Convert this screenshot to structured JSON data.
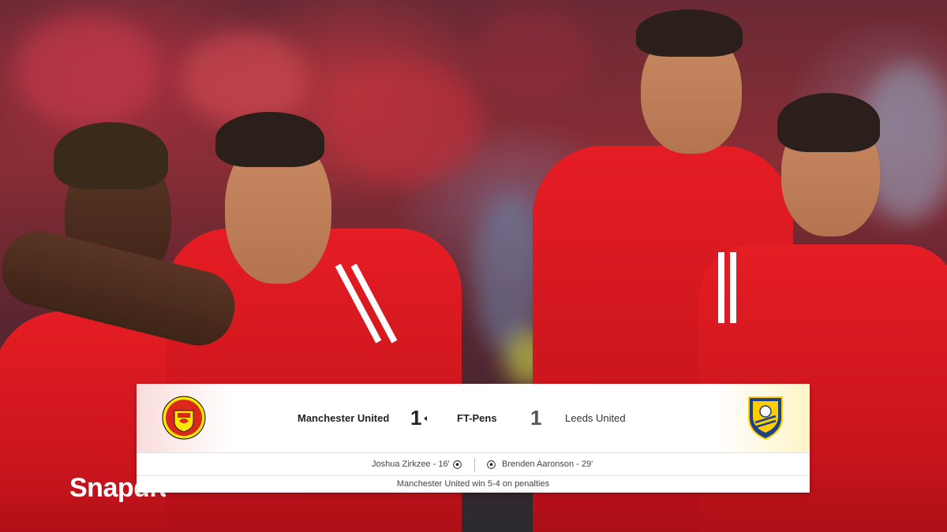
{
  "match": {
    "home_team": "Manchester United",
    "away_team": "Leeds United",
    "home_score": "1",
    "away_score": "1",
    "status": "FT-Pens",
    "home_scorer": "Joshua Zirkzee - 16'",
    "away_scorer": "Brenden Aaronson - 29'",
    "result_note": "Manchester United win 5-4 on penalties"
  },
  "crest_home": {
    "name": "manchester-united-crest",
    "text_top": "MANCHESTER",
    "text_bottom": "UNITED"
  },
  "crest_away": {
    "name": "leeds-united-crest"
  },
  "shirt_sponsor": "Snapdragon",
  "colors": {
    "home_primary": "#da291c",
    "away_primary": "#ffcd00",
    "away_secondary": "#1d428a",
    "panel_bg": "#ffffff"
  },
  "icons": [
    "football-icon",
    "winner-caret-icon"
  ]
}
